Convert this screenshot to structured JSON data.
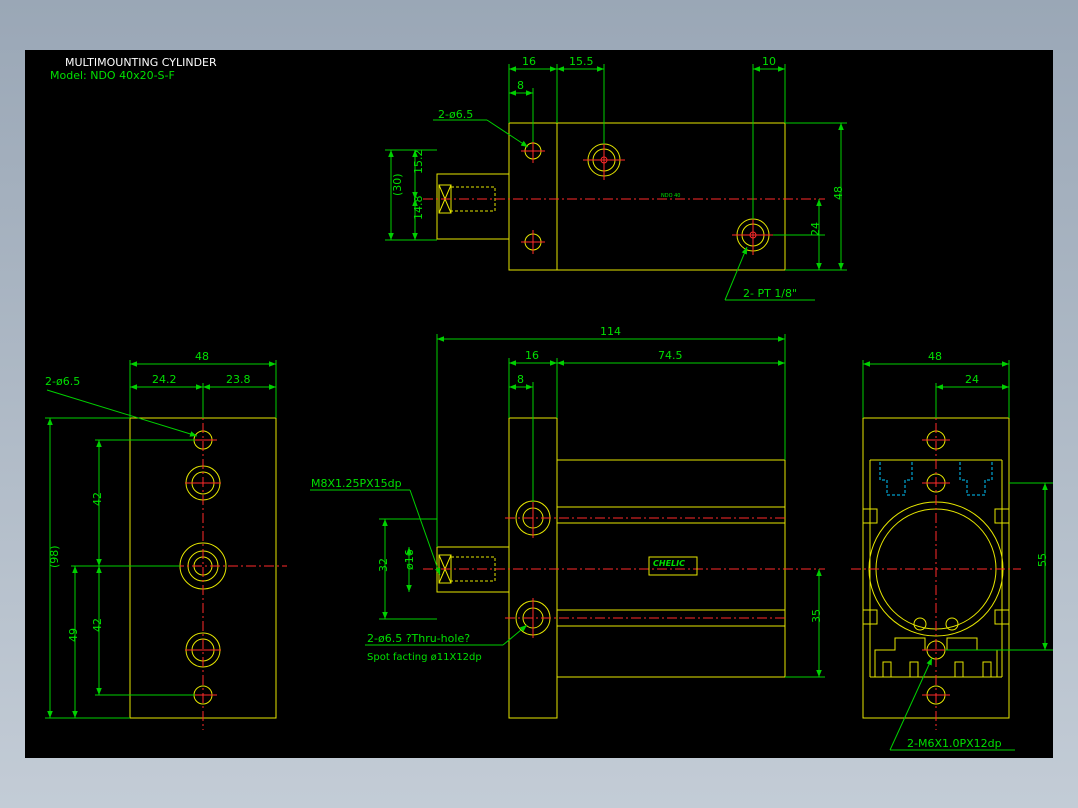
{
  "title": {
    "line1": "MULTIMOUNTING CYLINDER",
    "line2": "Model: NDO 40x20-S-F"
  },
  "top_view": {
    "dim_16": "16",
    "dim_15_5": "15.5",
    "dim_10": "10",
    "dim_8": "8",
    "hole_note": "2-ø6.5",
    "dim_30": "(30)",
    "dim_15_2": "15.2",
    "dim_14_8": "14.8",
    "dim_48": "48",
    "dim_24": "24",
    "port_note": "2- PT 1/8\""
  },
  "left_view": {
    "dim_48": "48",
    "dim_24_2": "24.2",
    "dim_23_8": "23.8",
    "hole_note": "2-ø6.5",
    "dim_42_top": "42",
    "dim_42_bottom": "42",
    "dim_98": "(98)",
    "dim_49": "49"
  },
  "front_view": {
    "dim_114": "114",
    "dim_16": "16",
    "dim_74_5": "74.5",
    "dim_8": "8",
    "thread_note": "M8X1.25PX15dp",
    "dim_32": "32",
    "dim_16_dia": "ø16",
    "dim_35": "35",
    "hole_note_1": "2-ø6.5 ?Thru-hole?",
    "hole_note_2": "Spot facting ø11X12dp",
    "label_brand": "CHELIC"
  },
  "right_view": {
    "dim_48": "48",
    "dim_24": "24",
    "dim_55": "55",
    "thread_note": "2-M6X1.0PX12dp"
  },
  "colors": {
    "outline": "#e6e600",
    "dimension": "#00d000",
    "centerline": "#ff2a2a",
    "hidden": "#00c8ff",
    "background": "#000000"
  }
}
